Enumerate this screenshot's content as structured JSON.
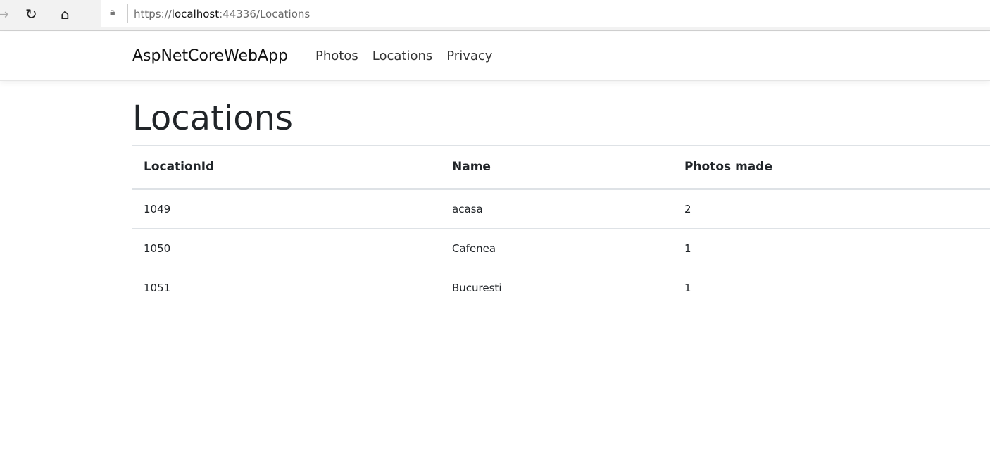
{
  "browser": {
    "url_prefix": "https://",
    "url_host": "localhost",
    "url_rest": ":44336/Locations",
    "icons": [
      "back-arrow-icon",
      "refresh-icon",
      "home-icon",
      "lock-icon"
    ]
  },
  "navbar": {
    "brand": "AspNetCoreWebApp",
    "links": [
      "Photos",
      "Locations",
      "Privacy"
    ]
  },
  "page": {
    "title": "Locations"
  },
  "table": {
    "headers": [
      "LocationId",
      "Name",
      "Photos made"
    ],
    "rows": [
      [
        "1049",
        "acasa",
        "2"
      ],
      [
        "1050",
        "Cafenea",
        "1"
      ],
      [
        "1051",
        "Bucuresti",
        "1"
      ]
    ]
  }
}
